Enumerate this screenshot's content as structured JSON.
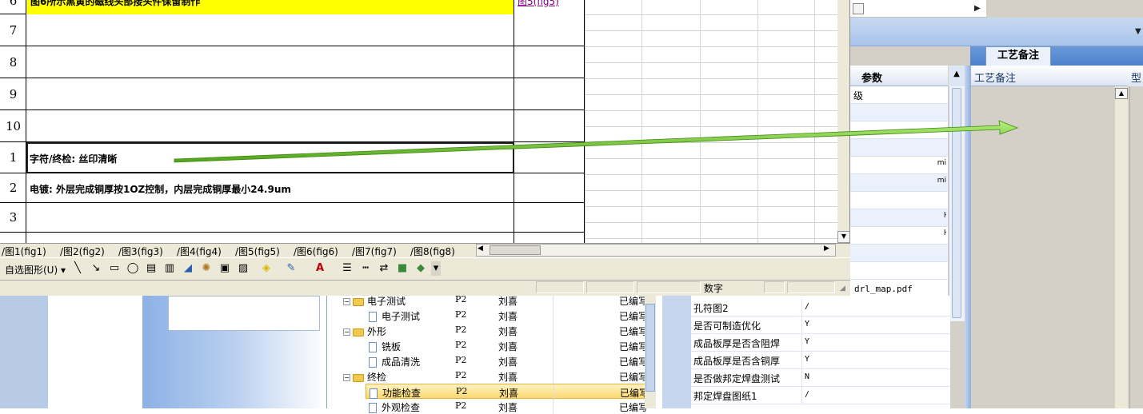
{
  "spreadsheet": {
    "top_partial_row": {
      "header": "6",
      "text": "图6所示黑黄的磁线头部接头件保留制作",
      "link": "图5(fig5)"
    },
    "rows": [
      {
        "header": "7",
        "text": ""
      },
      {
        "header": "8",
        "text": ""
      },
      {
        "header": "9",
        "text": ""
      },
      {
        "header": "10",
        "text": ""
      },
      {
        "header": "1",
        "text": "字符/终检: 丝印清晰"
      },
      {
        "header": "2",
        "text": "电镀: 外层完成铜厚按1OZ控制，内层完成铜厚最小24.9um"
      },
      {
        "header": "3",
        "text": ""
      }
    ],
    "sheet_tabs": [
      "图1(fig1)",
      "图2(fig2)",
      "图3(fig3)",
      "图4(fig4)",
      "图5(fig5)",
      "图6(fig6)",
      "图7(fig7)",
      "图8(fig8)"
    ],
    "draw_toolbar": {
      "autoshapes_label": "自选图形(U)"
    },
    "status": {
      "numlock": "数字"
    }
  },
  "right_app": {
    "tab_label": "工艺备注",
    "params_header": "参数",
    "param_rows": [
      {
        "text": "级",
        "right": ""
      },
      {
        "text": "",
        "right": ""
      },
      {
        "text": "",
        "right": ""
      },
      {
        "text": "",
        "right": ""
      },
      {
        "text": "",
        "right": "mi"
      },
      {
        "text": "",
        "right": "mi"
      },
      {
        "text": "",
        "right": ""
      },
      {
        "text": "",
        "right": "ŀ"
      },
      {
        "text": "",
        "right": "ŀ"
      },
      {
        "text": "",
        "right": ""
      },
      {
        "text": "",
        "right": ""
      }
    ],
    "notes_header": "工艺备注",
    "notes_header2": "型",
    "drl_map_value": "drl_map.pdf"
  },
  "tree": {
    "rows": [
      {
        "name": "电子测试",
        "level": 0,
        "folder": true,
        "expanded": true,
        "code": "P2",
        "owner": "刘喜",
        "status": "已编写"
      },
      {
        "name": "电子测试",
        "level": 1,
        "folder": false,
        "code": "P2",
        "owner": "刘喜",
        "status": "已编写"
      },
      {
        "name": "外形",
        "level": 0,
        "folder": true,
        "expanded": true,
        "code": "P2",
        "owner": "刘喜",
        "status": "已编写"
      },
      {
        "name": "铣板",
        "level": 1,
        "folder": false,
        "code": "P2",
        "owner": "刘喜",
        "status": "已编写"
      },
      {
        "name": "成品清洗",
        "level": 1,
        "folder": false,
        "code": "P2",
        "owner": "刘喜",
        "status": "已编写"
      },
      {
        "name": "终检",
        "level": 0,
        "folder": true,
        "expanded": true,
        "code": "P2",
        "owner": "刘喜",
        "status": "已编写"
      },
      {
        "name": "功能检查",
        "level": 1,
        "folder": false,
        "code": "P2",
        "owner": "刘喜",
        "status": "已编写",
        "selected": true
      },
      {
        "name": "外观检查",
        "level": 1,
        "folder": false,
        "code": "P2",
        "owner": "刘喜",
        "status": "已编写"
      }
    ]
  },
  "properties": [
    {
      "name": "孔符图2",
      "value": "/"
    },
    {
      "name": "是否可制造优化",
      "value": "Y"
    },
    {
      "name": "成品板厚是否含阻焊",
      "value": "Y"
    },
    {
      "name": "成品板厚是否含铜厚",
      "value": "Y"
    },
    {
      "name": "是否做邦定焊盘测试",
      "value": "N"
    },
    {
      "name": "邦定焊盘图纸1",
      "value": "/"
    }
  ],
  "colors": {
    "highlight_yellow": "#ffff00",
    "link_purple": "#800080",
    "arrow_green": "#7ed321",
    "selection_gold": "#fbd970"
  }
}
